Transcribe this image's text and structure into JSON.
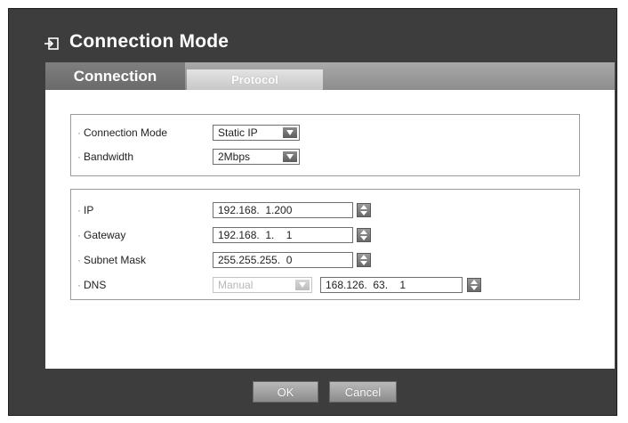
{
  "window": {
    "title": "Connection Mode",
    "title_icon": "login-icon"
  },
  "tabs": [
    {
      "label": "Connection",
      "active": true
    },
    {
      "label": "Protocol",
      "active": false
    }
  ],
  "connection_group": {
    "connection_mode": {
      "label": "Connection Mode",
      "value": "Static IP"
    },
    "bandwidth": {
      "label": "Bandwidth",
      "value": "2Mbps"
    }
  },
  "network_group": {
    "ip": {
      "label": "IP",
      "value": "192.168.  1.200"
    },
    "gateway": {
      "label": "Gateway",
      "value": "192.168.  1.    1"
    },
    "subnet_mask": {
      "label": "Subnet Mask",
      "value": "255.255.255.  0"
    },
    "dns": {
      "label": "DNS",
      "mode": "Manual",
      "value": "168.126.  63.    1"
    }
  },
  "buttons": {
    "ok": "OK",
    "cancel": "Cancel"
  },
  "colors": {
    "window_bg": "#3d3d3d",
    "active_tab": "#737373",
    "inactive_tab": "#d5d5d5",
    "content_bg": "#ffffff"
  }
}
